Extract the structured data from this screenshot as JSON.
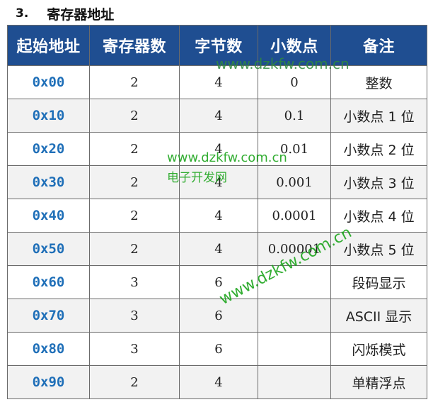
{
  "heading": {
    "number": "3.",
    "title": "寄存器地址"
  },
  "table": {
    "columns": [
      "起始地址",
      "寄存器数",
      "字节数",
      "小数点",
      "备注"
    ],
    "rows": [
      {
        "address": "0x00",
        "registers": "2",
        "bytes": "4",
        "decimal": "0",
        "note": "整数"
      },
      {
        "address": "0x10",
        "registers": "2",
        "bytes": "4",
        "decimal": "0.1",
        "note": "小数点 1 位"
      },
      {
        "address": "0x20",
        "registers": "2",
        "bytes": "4",
        "decimal": "0.01",
        "note": "小数点 2 位"
      },
      {
        "address": "0x30",
        "registers": "2",
        "bytes": "4",
        "decimal": "0.001",
        "note": "小数点 3 位"
      },
      {
        "address": "0x40",
        "registers": "2",
        "bytes": "4",
        "decimal": "0.0001",
        "note": "小数点 4 位"
      },
      {
        "address": "0x50",
        "registers": "2",
        "bytes": "4",
        "decimal": "0.00001",
        "note": "小数点 5 位"
      },
      {
        "address": "0x60",
        "registers": "3",
        "bytes": "6",
        "decimal": "",
        "note": "段码显示"
      },
      {
        "address": "0x70",
        "registers": "3",
        "bytes": "6",
        "decimal": "",
        "note": "ASCII 显示"
      },
      {
        "address": "0x80",
        "registers": "3",
        "bytes": "6",
        "decimal": "",
        "note": "闪烁模式"
      },
      {
        "address": "0x90",
        "registers": "2",
        "bytes": "4",
        "decimal": "",
        "note": "单精浮点"
      }
    ]
  },
  "watermarks": {
    "top": "www.dzkfw.com.cn",
    "middle_url": "www.dzkfw.com.cn",
    "middle_name": "电子开发网",
    "diagonal": "www.dzkfw.com.cn"
  },
  "colors": {
    "header_bg": "#1F4E91",
    "address_text": "#1F6FB8",
    "watermark": "#1ca51c"
  }
}
